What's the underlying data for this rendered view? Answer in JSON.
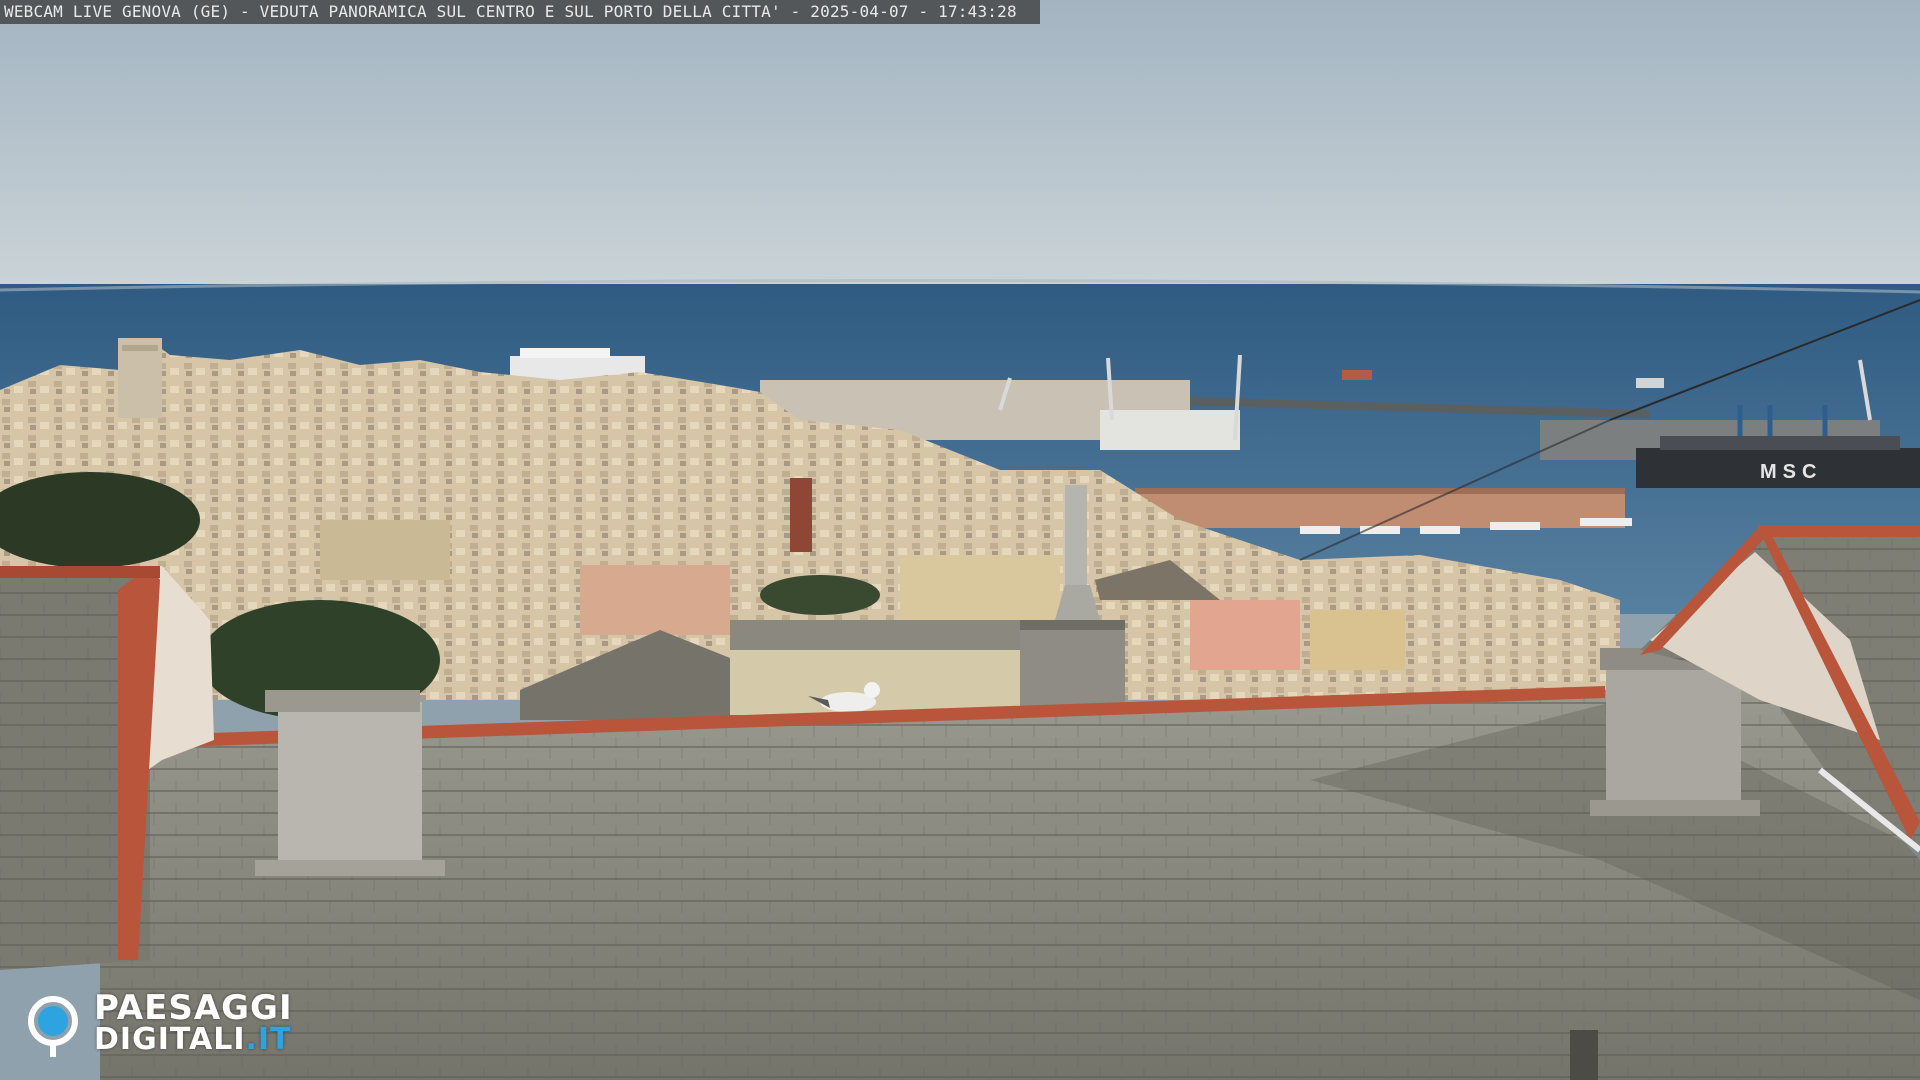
{
  "overlay": {
    "caption": "WEBCAM LIVE GENOVA (GE) - VEDUTA PANORAMICA SUL CENTRO E SUL PORTO DELLA CITTA' - 2025-04-07 - 17:43:28"
  },
  "logo": {
    "line1": "PAESAGGI",
    "line2_main": "DIGITALI",
    "line2_suffix": ".IT",
    "ring_color": "#ffffff",
    "accent_color": "#2da3e0"
  },
  "ship_marking": "MSC",
  "colors": {
    "sky_top": "#a9b9c4",
    "sky_bottom": "#c9d3d8",
    "sea": "#3f6a8e",
    "roof_slate": "#8c8b82",
    "terracotta": "#b8553a",
    "city": "#d8c7a8"
  }
}
